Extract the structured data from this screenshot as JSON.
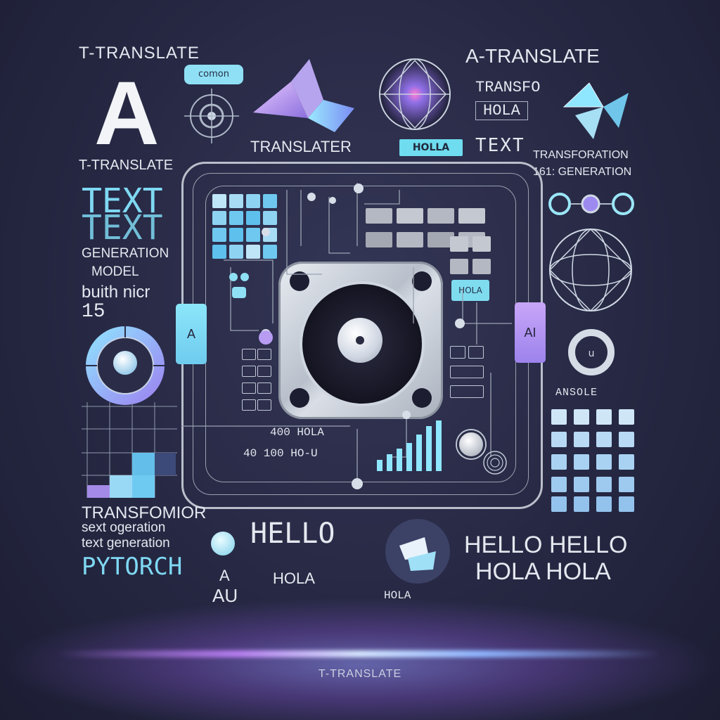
{
  "colors": {
    "background": "#262843",
    "accent_cyan": "#7fd8f2",
    "accent_purple": "#b48cf0",
    "silver": "#e4e8ef"
  },
  "left": {
    "top_label": "T-TRANSLATE",
    "big_letter": "A",
    "sub_label": "T-TRANSLATE",
    "text_1": "TEXT",
    "text_2": "TEXT",
    "generation": "GENERATION",
    "model": "MODEL",
    "built": "buith nicr",
    "number": "15"
  },
  "top": {
    "pill": "comon",
    "translater": "TRANSLATER",
    "hola_badge": "HOLLA"
  },
  "right": {
    "top_label": "A-TRANSLATE",
    "transfo": "TRANSFO",
    "hola": "HOLA",
    "text": "TEXT",
    "transformation": "TRANSFORATION",
    "generation": "161: GENERATION",
    "ansole": "ANSOLE"
  },
  "board": {
    "chip_left": "A",
    "chip_right": "AI",
    "cell_label": "HOLA",
    "row_1": "400 HOLA",
    "row_2": "40 100 HO-U"
  },
  "bottom_left": {
    "transformer": "TRANSFOMIOR",
    "text_generation_1": "sext ogeration",
    "text_generation_2": "text generation",
    "pytorch": "PYTORCH",
    "au": "AU",
    "a": "A"
  },
  "bottom_center": {
    "hello": "HELLO",
    "hola": "HOLA",
    "hola_small": "HOLA"
  },
  "bottom_right": {
    "line_1": "HELLO HELLO",
    "line_2": "HOLA HOLA"
  },
  "footer": {
    "brand": "T-TRANSLATE"
  }
}
